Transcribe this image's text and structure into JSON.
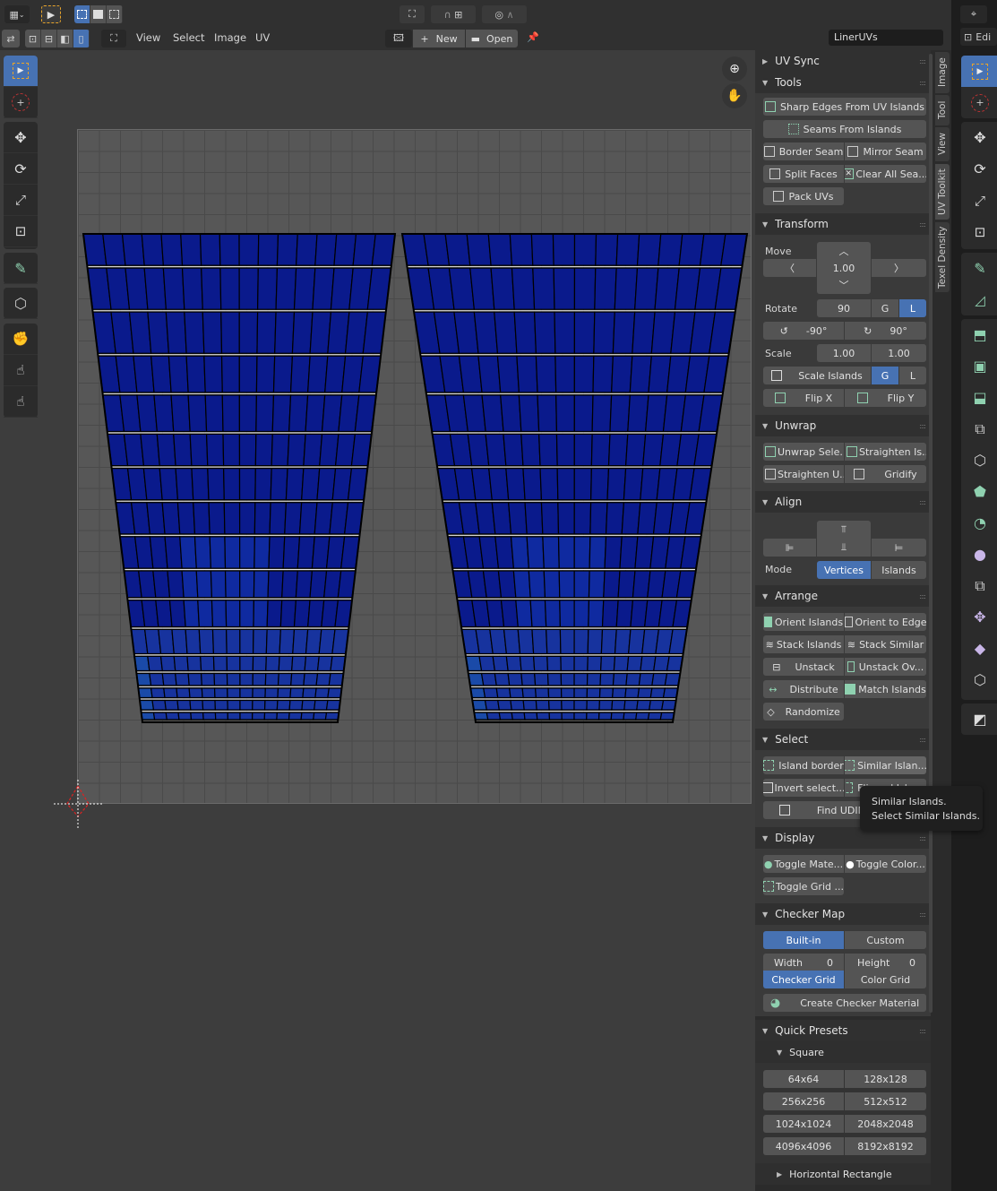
{
  "header": {
    "menus": [
      "View",
      "Select",
      "Image",
      "UV"
    ],
    "new_label": "New",
    "open_label": "Open",
    "image_name": "LinerUVs",
    "right_mode_label": "Edi"
  },
  "sidebar": {
    "uv_sync": "UV Sync",
    "tools": {
      "title": "Tools",
      "buttons": [
        "Sharp Edges From UV Islands",
        "Seams From Islands",
        "Border Seam",
        "Mirror Seam",
        "Split Faces",
        "Clear All Sea...",
        "Pack UVs"
      ]
    },
    "transform": {
      "title": "Transform",
      "move_label": "Move",
      "move_value": "1.00",
      "rotate_label": "Rotate",
      "rotate_value": "90",
      "g": "G",
      "l": "L",
      "rot_ccw": "-90°",
      "rot_cw": "90°",
      "scale_label": "Scale",
      "scale_x": "1.00",
      "scale_y": "1.00",
      "scale_islands": "Scale Islands",
      "flip_x": "Flip X",
      "flip_y": "Flip Y"
    },
    "unwrap": {
      "title": "Unwrap",
      "buttons": [
        "Unwrap Sele...",
        "Straighten Is...",
        "Straighten U...",
        "Gridify"
      ]
    },
    "align": {
      "title": "Align",
      "mode_label": "Mode",
      "vertices": "Vertices",
      "islands": "Islands"
    },
    "arrange": {
      "title": "Arrange",
      "buttons": [
        "Orient Islands",
        "Orient to Edge",
        "Stack Islands",
        "Stack Similar",
        "Unstack",
        "Unstack Ov...",
        "Distribute",
        "Match Islands",
        "Randomize"
      ]
    },
    "select": {
      "title": "Select",
      "buttons": [
        "Island border",
        "Similar Islan...",
        "Invert select...",
        "Flipped Islan...",
        "Find UDIM crossing"
      ]
    },
    "display": {
      "title": "Display",
      "buttons": [
        "Toggle Mate...",
        "Toggle Color...",
        "Toggle Grid ..."
      ]
    },
    "checker": {
      "title": "Checker Map",
      "builtin": "Built-in",
      "custom": "Custom",
      "width_label": "Width",
      "width_value": "0",
      "height_label": "Height",
      "height_value": "0",
      "checker_grid": "Checker Grid",
      "color_grid": "Color Grid",
      "create": "Create Checker Material"
    },
    "presets": {
      "title": "Quick Presets",
      "square": "Square",
      "sizes": [
        "64x64",
        "128x128",
        "256x256",
        "512x512",
        "1024x1024",
        "2048x2048",
        "4096x4096",
        "8192x8192"
      ],
      "horizontal": "Horizontal Rectangle"
    }
  },
  "tabs": [
    "Image",
    "Tool",
    "View",
    "UV Toolkit",
    "Texel Density"
  ],
  "tooltip": {
    "line1": "Similar Islands.",
    "line2": "Select Similar Islands."
  },
  "colors": {
    "accent": "#4772b3",
    "uv_fill": "#0a1a8c",
    "icon_green": "#8fd1b0"
  }
}
